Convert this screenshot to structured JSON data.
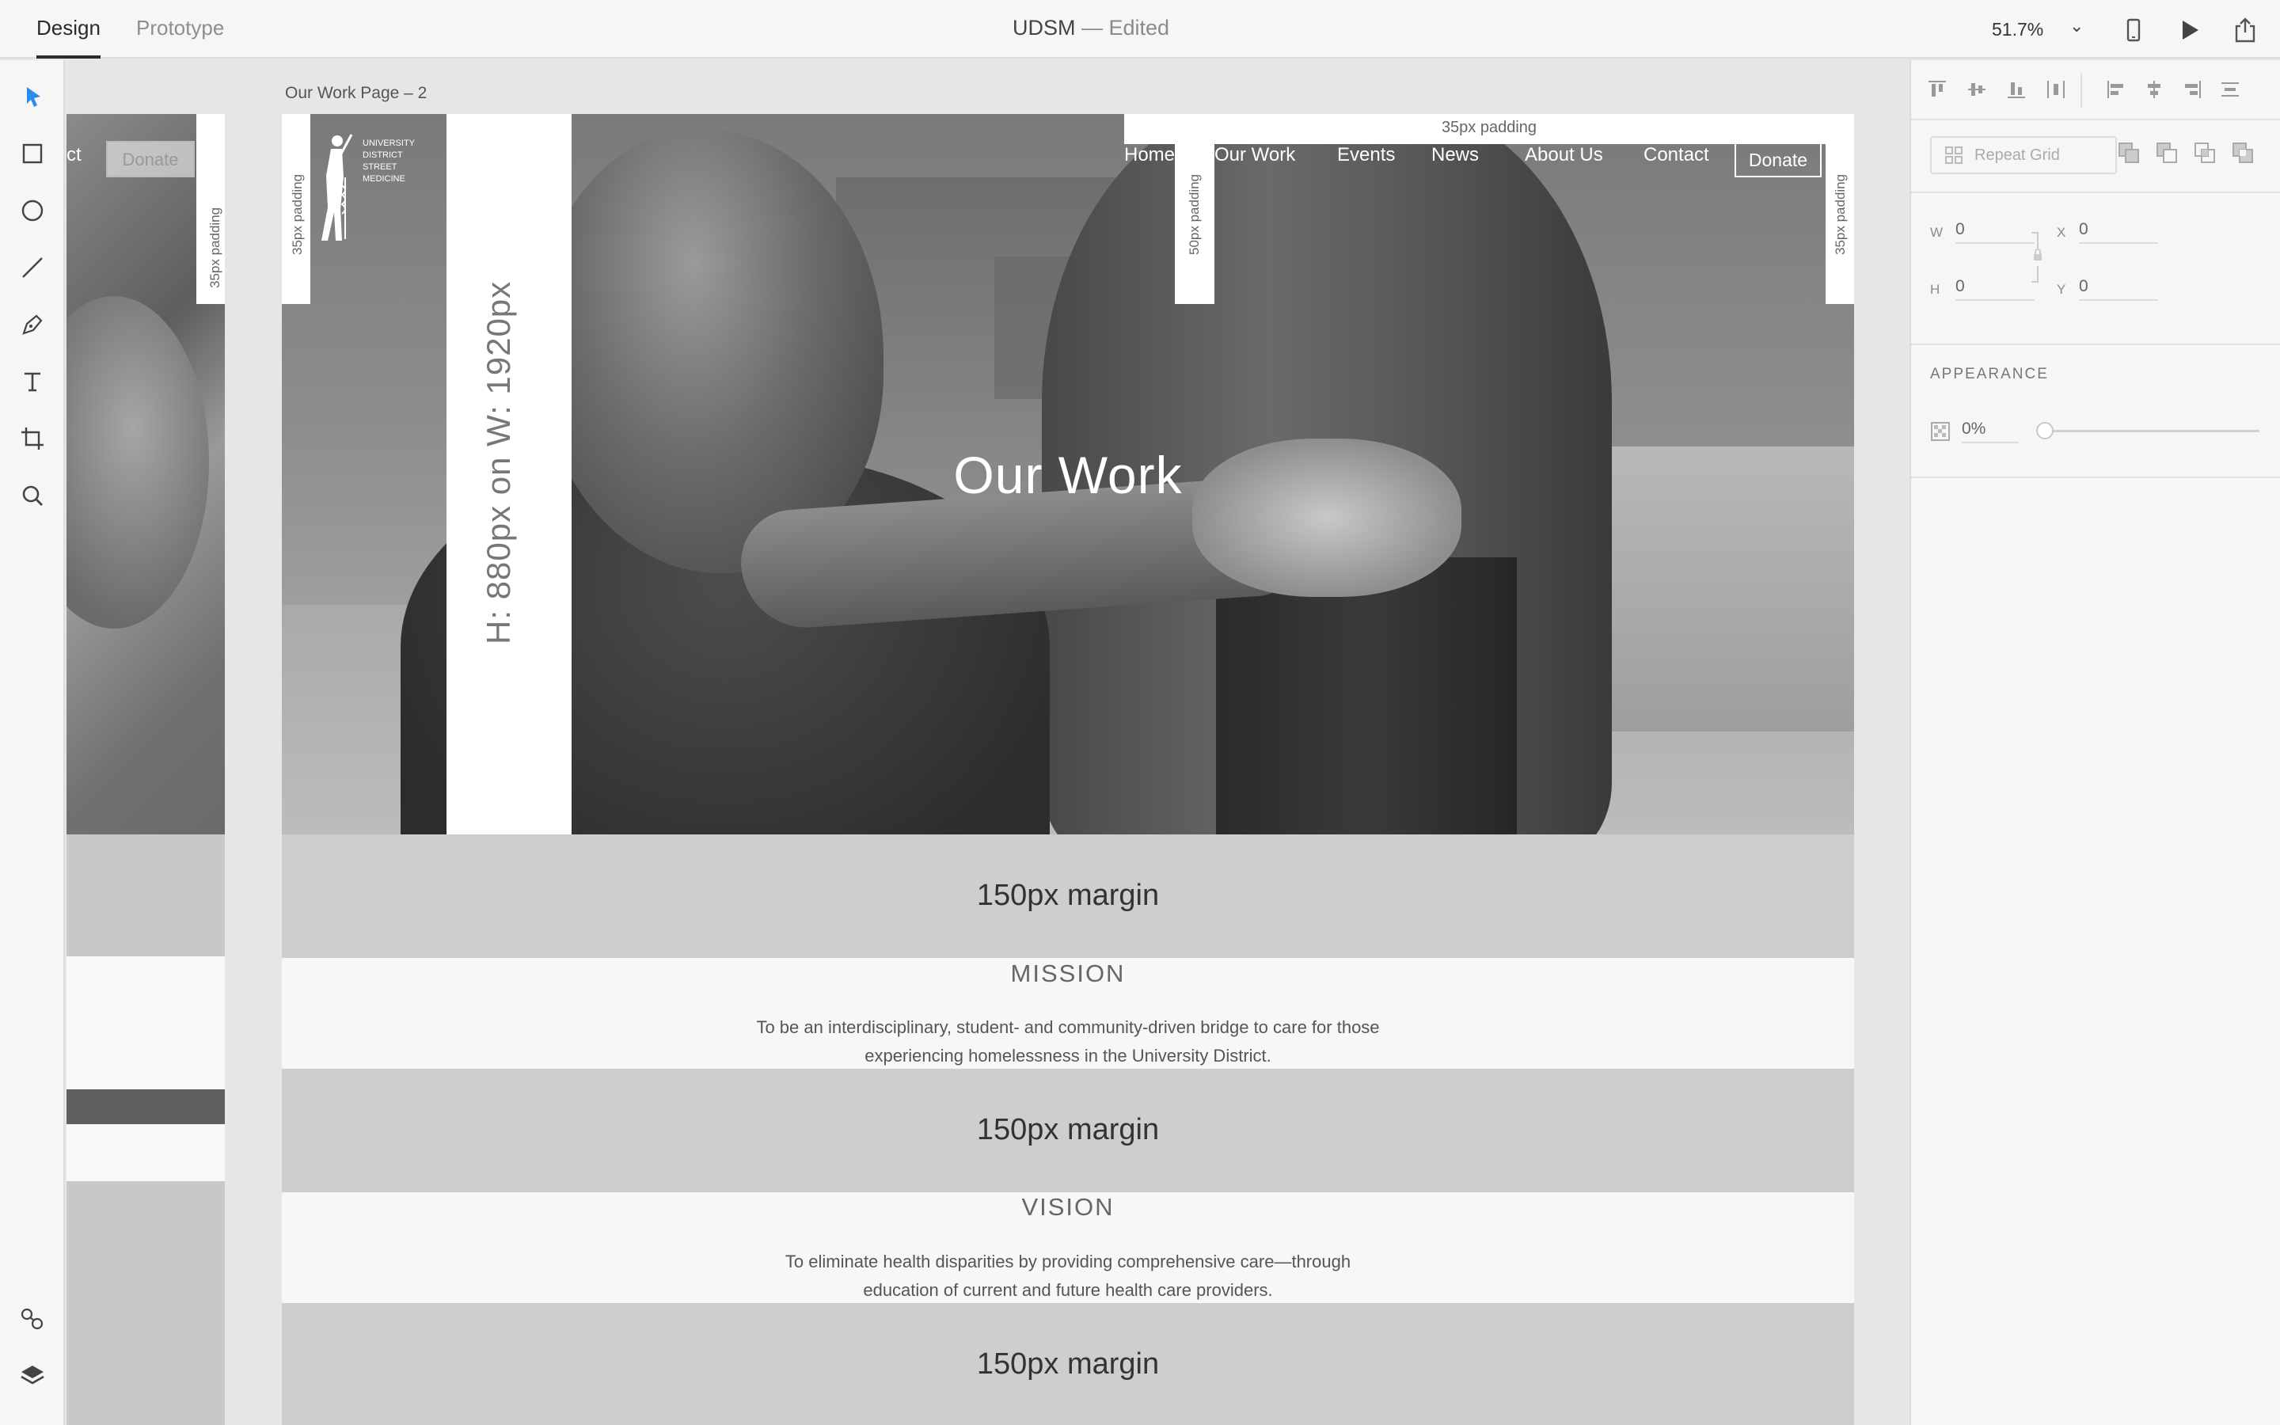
{
  "topbar": {
    "tabs": [
      "Design",
      "Prototype"
    ],
    "doc_name": "UDSM",
    "doc_status": " — Edited",
    "zoom": "51.7%"
  },
  "toolbar": {
    "tools": [
      "select-icon",
      "rectangle-icon",
      "ellipse-icon",
      "line-icon",
      "pen-icon",
      "text-icon",
      "artboard-icon",
      "zoom-icon"
    ],
    "bottom": [
      "assets-icon",
      "layers-icon"
    ]
  },
  "panel": {
    "repeat_grid": "Repeat Grid",
    "w_label": "W",
    "w_value": "0",
    "h_label": "H",
    "h_value": "0",
    "x_label": "X",
    "x_value": "0",
    "y_label": "Y",
    "y_value": "0",
    "appearance_title": "APPEARANCE",
    "opacity": "0%"
  },
  "artboard_left": {
    "nav_fragment": "ct",
    "donate": "Donate",
    "padding_label": "35px padding"
  },
  "artboard": {
    "name": "Our Work Page – 2",
    "logo_text": "UNIVERSITY DISTRICT STREET MEDICINE",
    "nav": [
      "Home",
      "Our Work",
      "Events",
      "News",
      "About Us",
      "Contact"
    ],
    "donate": "Donate",
    "hero_title": "Our Work",
    "padding_top": "35px padding",
    "padding_left": "35px padding",
    "padding_mid": "50px padding",
    "padding_right": "35px padding",
    "height_note": "H: 880px on W: 1920px",
    "margin_label": "150px margin",
    "mission_title": "MISSION",
    "mission_text_1": "To be an interdisciplinary, student- and community-driven bridge to care for those",
    "mission_text_2": "experiencing homelessness in the University District.",
    "vision_title": "VISION",
    "vision_text_1": "To eliminate health disparities by providing comprehensive care—through",
    "vision_text_2": "education of current and future health care providers."
  }
}
